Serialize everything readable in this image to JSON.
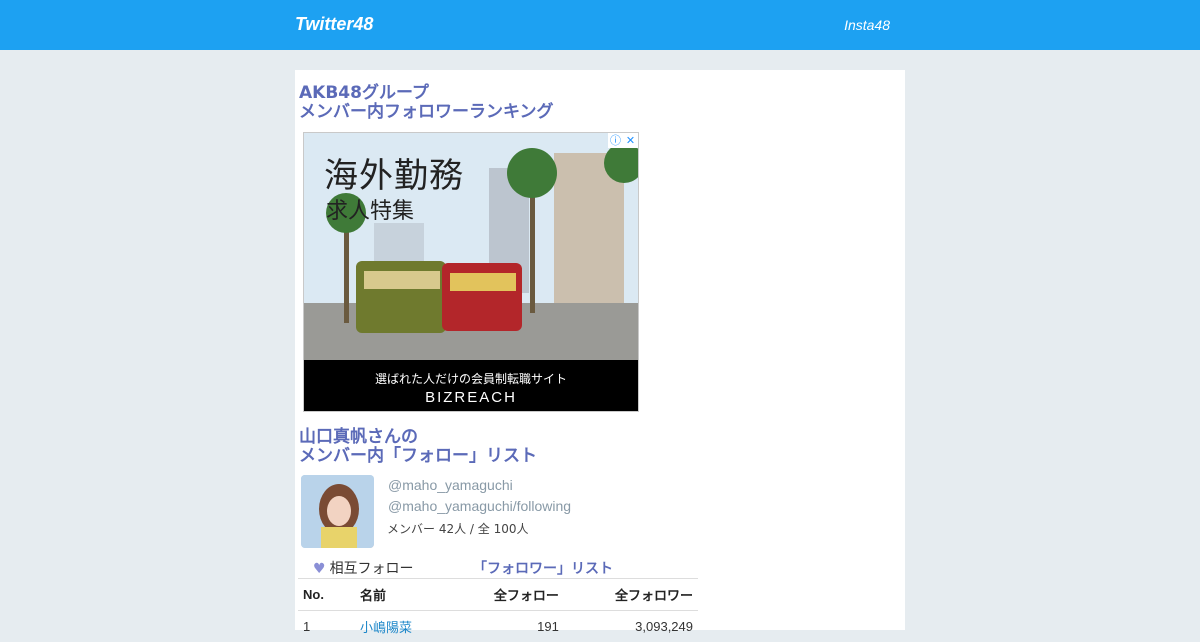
{
  "nav": {
    "brand": "Twitter48",
    "link": "Insta48"
  },
  "heading1": {
    "line1": "AKB48グループ",
    "line2": "メンバー内フォロワーランキング"
  },
  "ad": {
    "headline": "海外勤務",
    "subhead": "求人特集",
    "tagline": "選ばれた人だけの会員制転職サイト",
    "logo": "BIZREACH",
    "info_icon": "info-icon",
    "close_icon": "close-icon"
  },
  "heading2": {
    "line1": "山口真帆さんの",
    "line2": "メンバー内「フォロー」リスト"
  },
  "profile": {
    "handle": "@maho_yamaguchi",
    "following_path": "@maho_yamaguchi/following",
    "count_text": "メンバー 42人 / 全 100人"
  },
  "links": {
    "mutual": "相互フォロー",
    "follower_list": "「フォロワー」リスト",
    "heart_icon": "heart-icon"
  },
  "table": {
    "headers": [
      "No.",
      "名前",
      "全フォロー",
      "全フォロワー"
    ],
    "rows": [
      {
        "no": "1",
        "name": "小嶋陽菜",
        "follow": "191",
        "followers": "3,093,249"
      }
    ]
  },
  "colors": {
    "header_bg": "#1da1f2",
    "page_bg": "#e6ecf0",
    "accent": "#5b6ab8"
  }
}
